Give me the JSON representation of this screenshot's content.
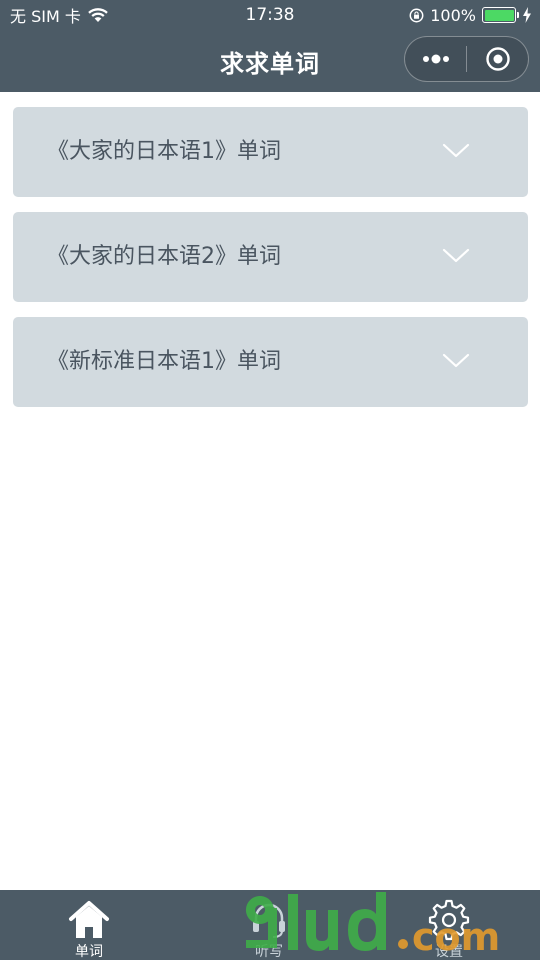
{
  "status_bar": {
    "carrier": "无 SIM 卡",
    "time": "17:38",
    "battery": "100%"
  },
  "nav": {
    "title": "求求单词"
  },
  "books": [
    {
      "label": "《大家的日本语1》单词"
    },
    {
      "label": "《大家的日本语2》单词"
    },
    {
      "label": "《新标准日本语1》单词"
    }
  ],
  "tabs": [
    {
      "label": "单词",
      "icon": "home-icon",
      "active": true
    },
    {
      "label": "听写",
      "icon": "headset-icon",
      "active": false
    },
    {
      "label": "设置",
      "icon": "gear-icon",
      "active": false
    }
  ],
  "watermark": {
    "text": "9lud.com"
  },
  "colors": {
    "header_bg": "#4c5b66",
    "card_bg": "#d2dadf",
    "card_text": "#4a5560",
    "battery_green": "#4cd964"
  }
}
